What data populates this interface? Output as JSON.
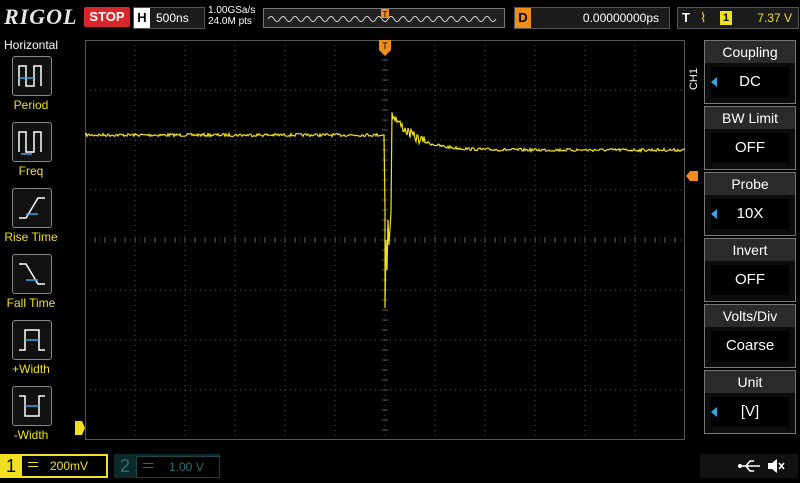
{
  "topbar": {
    "brand": "RIGOL",
    "run_state": "STOP",
    "horizontal_label": "H",
    "timebase": "500ns",
    "sample_rate": "1.00GSa/s",
    "memory_depth": "24.0M pts",
    "trigger_position_marker": "T",
    "delay_label": "D",
    "delay_value": "0.00000000ps",
    "trigger_label": "T",
    "trigger_source": "1",
    "trigger_level": "7.37 V"
  },
  "left_menu": {
    "title": "Horizontal",
    "items": [
      {
        "label": "Period",
        "icon": "period-icon"
      },
      {
        "label": "Freq",
        "icon": "frequency-icon"
      },
      {
        "label": "Rise Time",
        "icon": "rise-time-icon"
      },
      {
        "label": "Fall Time",
        "icon": "fall-time-icon"
      },
      {
        "label": "+Width",
        "icon": "positive-width-icon"
      },
      {
        "label": "-Width",
        "icon": "negative-width-icon"
      }
    ]
  },
  "right_menu": {
    "channel_tag": "CH1",
    "items": [
      {
        "title": "Coupling",
        "value": "DC"
      },
      {
        "title": "BW Limit",
        "value": "OFF"
      },
      {
        "title": "Probe",
        "value": "10X"
      },
      {
        "title": "Invert",
        "value": "OFF"
      },
      {
        "title": "Volts/Div",
        "value": "Coarse"
      },
      {
        "title": "Unit",
        "value": "[V]"
      }
    ]
  },
  "bottombar": {
    "ch1_number": "1",
    "ch1_scale": "200mV",
    "ch2_number": "2",
    "ch2_scale": "1.00 V"
  },
  "colors": {
    "ch1": "#f0e020",
    "trigger": "#f28c18",
    "stop": "#d8262a",
    "grid": "#555555"
  }
}
